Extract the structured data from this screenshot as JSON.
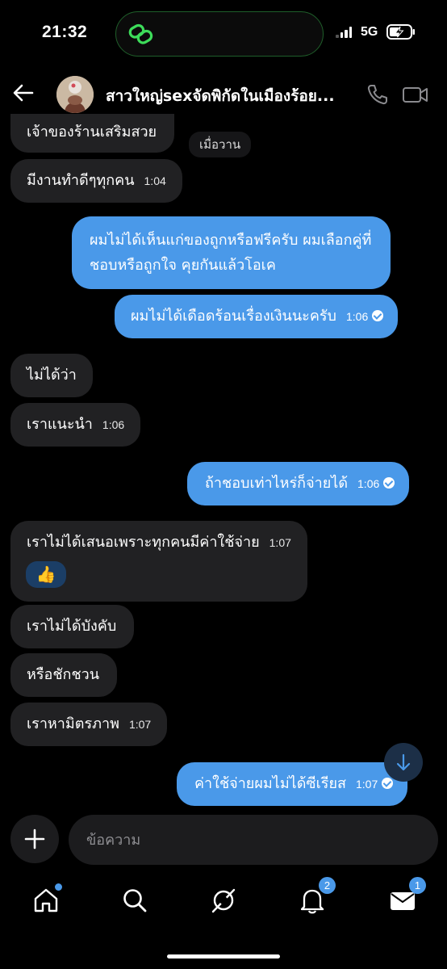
{
  "status": {
    "time": "21:32",
    "network": "5G"
  },
  "header": {
    "title": "สาวใหญ่sexจัดพิกัดในเมืองร้อย..."
  },
  "day_label": "เมื่อวาน",
  "messages": [
    {
      "text": "เจ้าของร้านเสริมสวย",
      "time": ""
    },
    {
      "text": "มีงานทำดีๆทุกคน",
      "time": "1:04"
    },
    {
      "text": "ผมไม่ได้เห็นแก่ของถูกหรือฟรีครับ ผมเลือกคู่ที่",
      "text2": "ชอบหรือถูกใจ คุยกันแล้วโอเค",
      "time": ""
    },
    {
      "text": "ผมไม่ได้เดือดร้อนเรื่องเงินนะครับ",
      "time": "1:06"
    },
    {
      "text": "ไม่ได้ว่า",
      "time": ""
    },
    {
      "text": "เราแนะนำ",
      "time": "1:06"
    },
    {
      "text": "ถ้าชอบเท่าไหร่ก็จ่ายได้",
      "time": "1:06"
    },
    {
      "text": "เราไม่ได้เสนอเพราะทุกคนมีค่าใช้จ่าย",
      "time": "1:07"
    },
    {
      "text": "👍",
      "time": ""
    },
    {
      "text": "เราไม่ได้บังคับ",
      "time": ""
    },
    {
      "text": "หรือชักชวน",
      "time": ""
    },
    {
      "text": "เราหามิตรภาพ",
      "time": "1:07"
    },
    {
      "text": "ค่าใช้จ่ายผมไม่ได้ซีเรียส",
      "time": "1:07"
    }
  ],
  "composer": {
    "placeholder": "ข้อความ"
  },
  "tabs": {
    "notifications_badge": "2",
    "messages_badge": "1"
  },
  "colors": {
    "accent": "#4a99e9",
    "incoming_bubble": "#212123",
    "background": "#000000"
  }
}
